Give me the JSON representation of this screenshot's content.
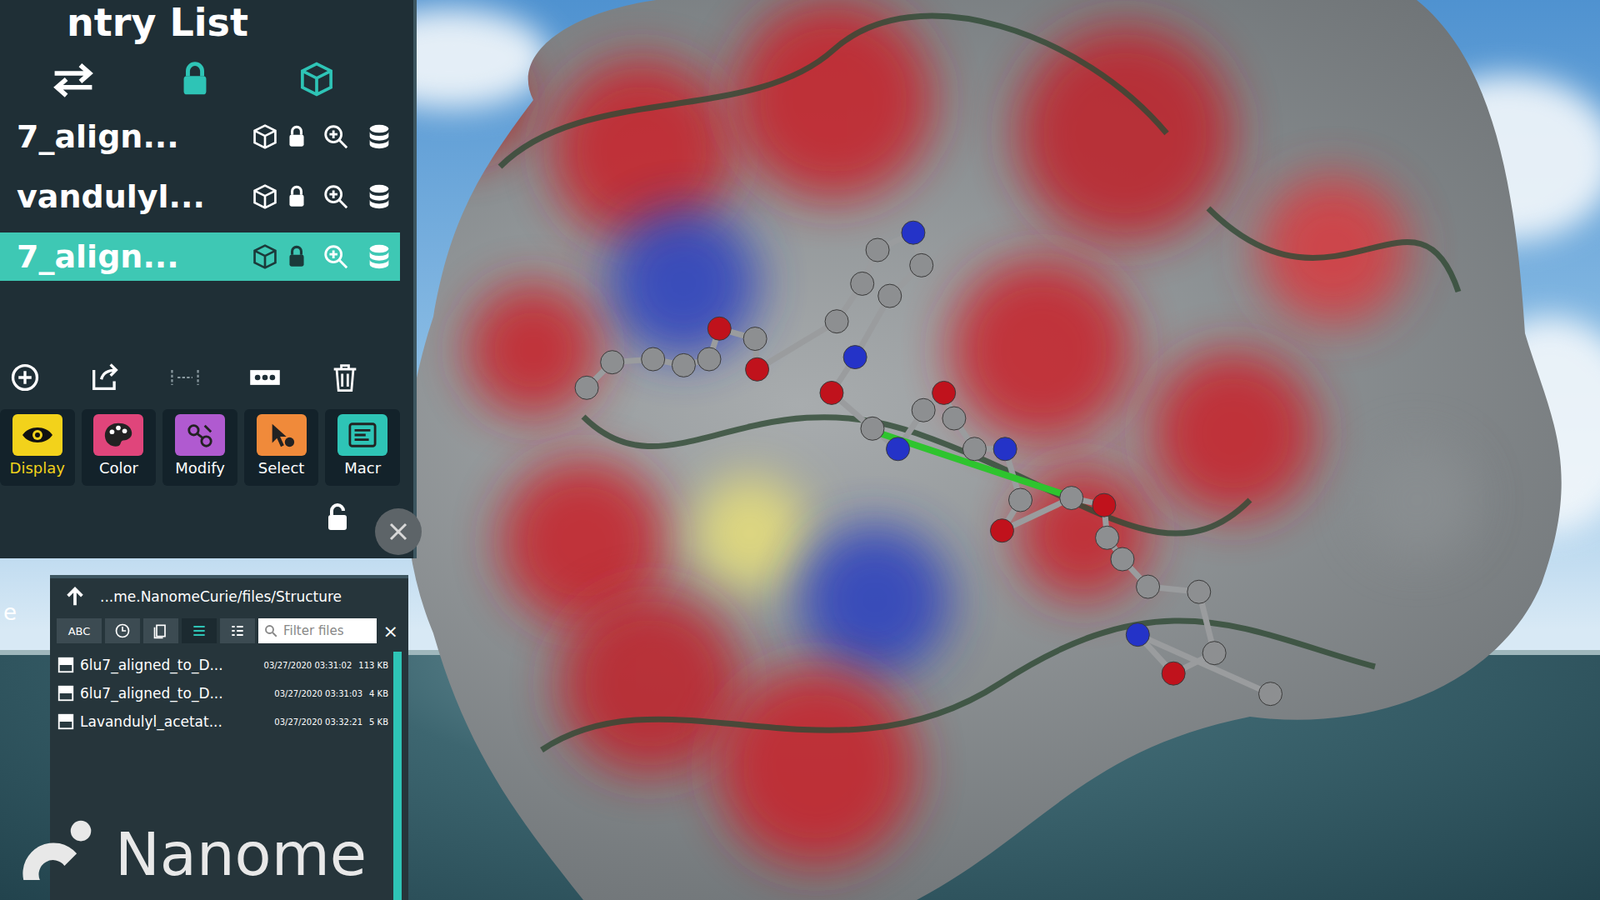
{
  "panel": {
    "title": "ntry List",
    "entries": [
      {
        "name": "7_align...",
        "selected": false,
        "locked": true
      },
      {
        "name": "vandulyl...",
        "selected": false,
        "locked": true
      },
      {
        "name": "7_align...",
        "selected": true,
        "locked": true
      }
    ],
    "menu": [
      {
        "label": "Display",
        "selected": true,
        "color": "#f2d21b"
      },
      {
        "label": "Color",
        "selected": false,
        "color": "#e0457b"
      },
      {
        "label": "Modify",
        "selected": false,
        "color": "#b05ad0"
      },
      {
        "label": "Select",
        "selected": false,
        "color": "#f08a3a"
      },
      {
        "label": "Macr",
        "selected": false,
        "color": "#2ec4b6"
      }
    ]
  },
  "side_label": "e",
  "browser": {
    "path": "...me.NanomeCurie/files/Structure",
    "sort_label": "ABC",
    "search_placeholder": "Filter files",
    "clear": "×",
    "files": [
      {
        "name": "6lu7_aligned_to_D...",
        "date": "03/27/2020 03:31:02",
        "size": "113 KB"
      },
      {
        "name": "6lu7_aligned_to_D...",
        "date": "03/27/2020 03:31:03",
        "size": "4 KB"
      },
      {
        "name": "Lavandulyl_acetat...",
        "date": "03/27/2020 03:32:21",
        "size": "5 KB"
      }
    ]
  },
  "watermark": "Nanome"
}
